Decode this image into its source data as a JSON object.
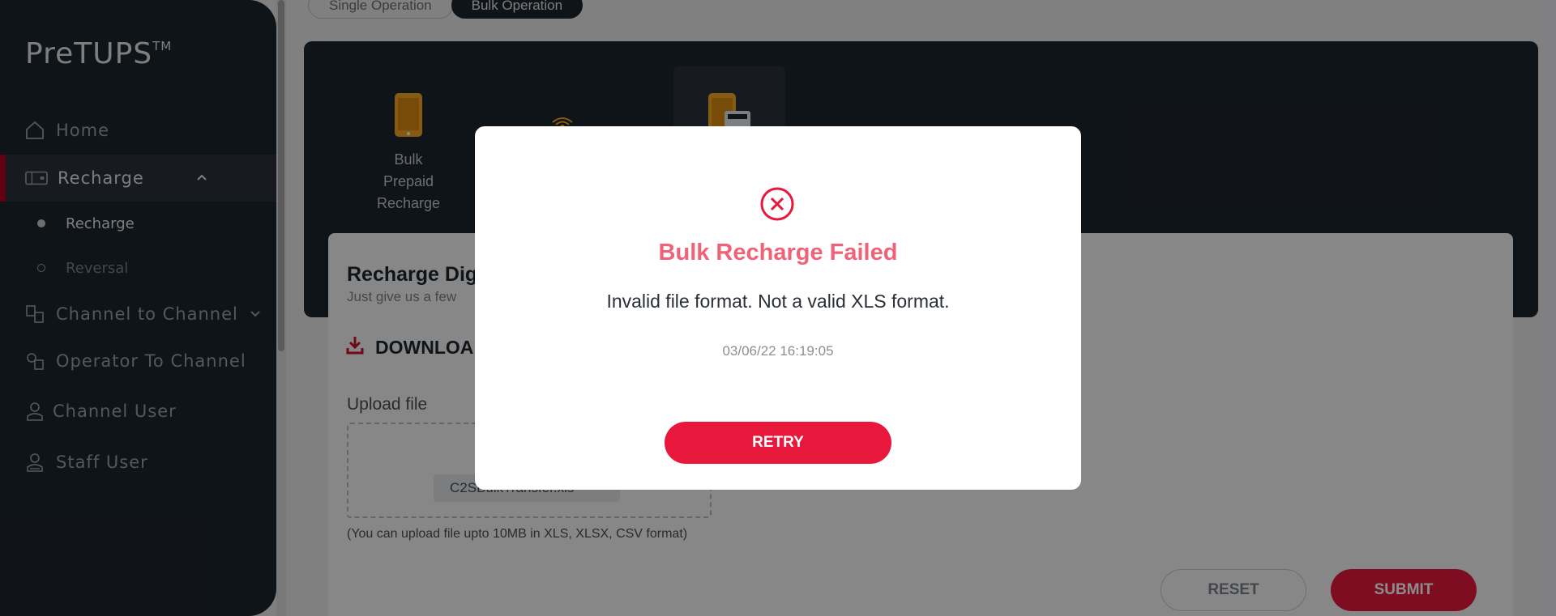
{
  "app": {
    "logo": "PreTUPS",
    "logo_tm": "TM"
  },
  "sidebar": {
    "items": [
      {
        "label": "Home",
        "icon": "home-icon"
      },
      {
        "label": "Recharge",
        "icon": "recharge-card-icon",
        "expanded": true
      },
      {
        "label": "Channel to Channel",
        "icon": "channel-transfer-icon"
      },
      {
        "label": "Operator To Channel",
        "icon": "operator-transfer-icon"
      },
      {
        "label": "Channel User",
        "icon": "user-icon"
      },
      {
        "label": "Staff User",
        "icon": "staff-user-icon"
      }
    ],
    "sub_items": [
      {
        "label": "Recharge",
        "selected": true
      },
      {
        "label": "Reversal",
        "selected": false
      }
    ]
  },
  "tabs": [
    {
      "label": "Single Operation",
      "active": false
    },
    {
      "label": "Bulk Operation",
      "active": true
    }
  ],
  "operations": [
    {
      "label": "Bulk Prepaid Recharge",
      "label_lines": [
        "Bulk",
        "Prepaid",
        "Recharge"
      ],
      "icon": "mobile-phone-icon"
    },
    {
      "label": "",
      "icon": "router-icon"
    },
    {
      "label": "",
      "icon": "mobile-card-icon",
      "selected": true
    }
  ],
  "form": {
    "title": "Recharge Dig",
    "subtitle": "Just give us a few",
    "download_label": "DOWNLOA",
    "upload_label": "Upload file",
    "file_name": "C2SBulkTransfer.xls",
    "upload_hint": "(You can upload file upto 10MB in XLS, XLSX, CSV format)",
    "reset_label": "RESET",
    "submit_label": "SUBMIT"
  },
  "modal": {
    "title": "Bulk Recharge Failed",
    "message": "Invalid file format. Not a valid XLS format.",
    "timestamp": "03/06/22 16:19:05",
    "retry_label": "RETRY"
  },
  "colors": {
    "sidebar_bg": "#1d252c",
    "accent_red": "#e8183c",
    "error_title": "#f06277"
  }
}
